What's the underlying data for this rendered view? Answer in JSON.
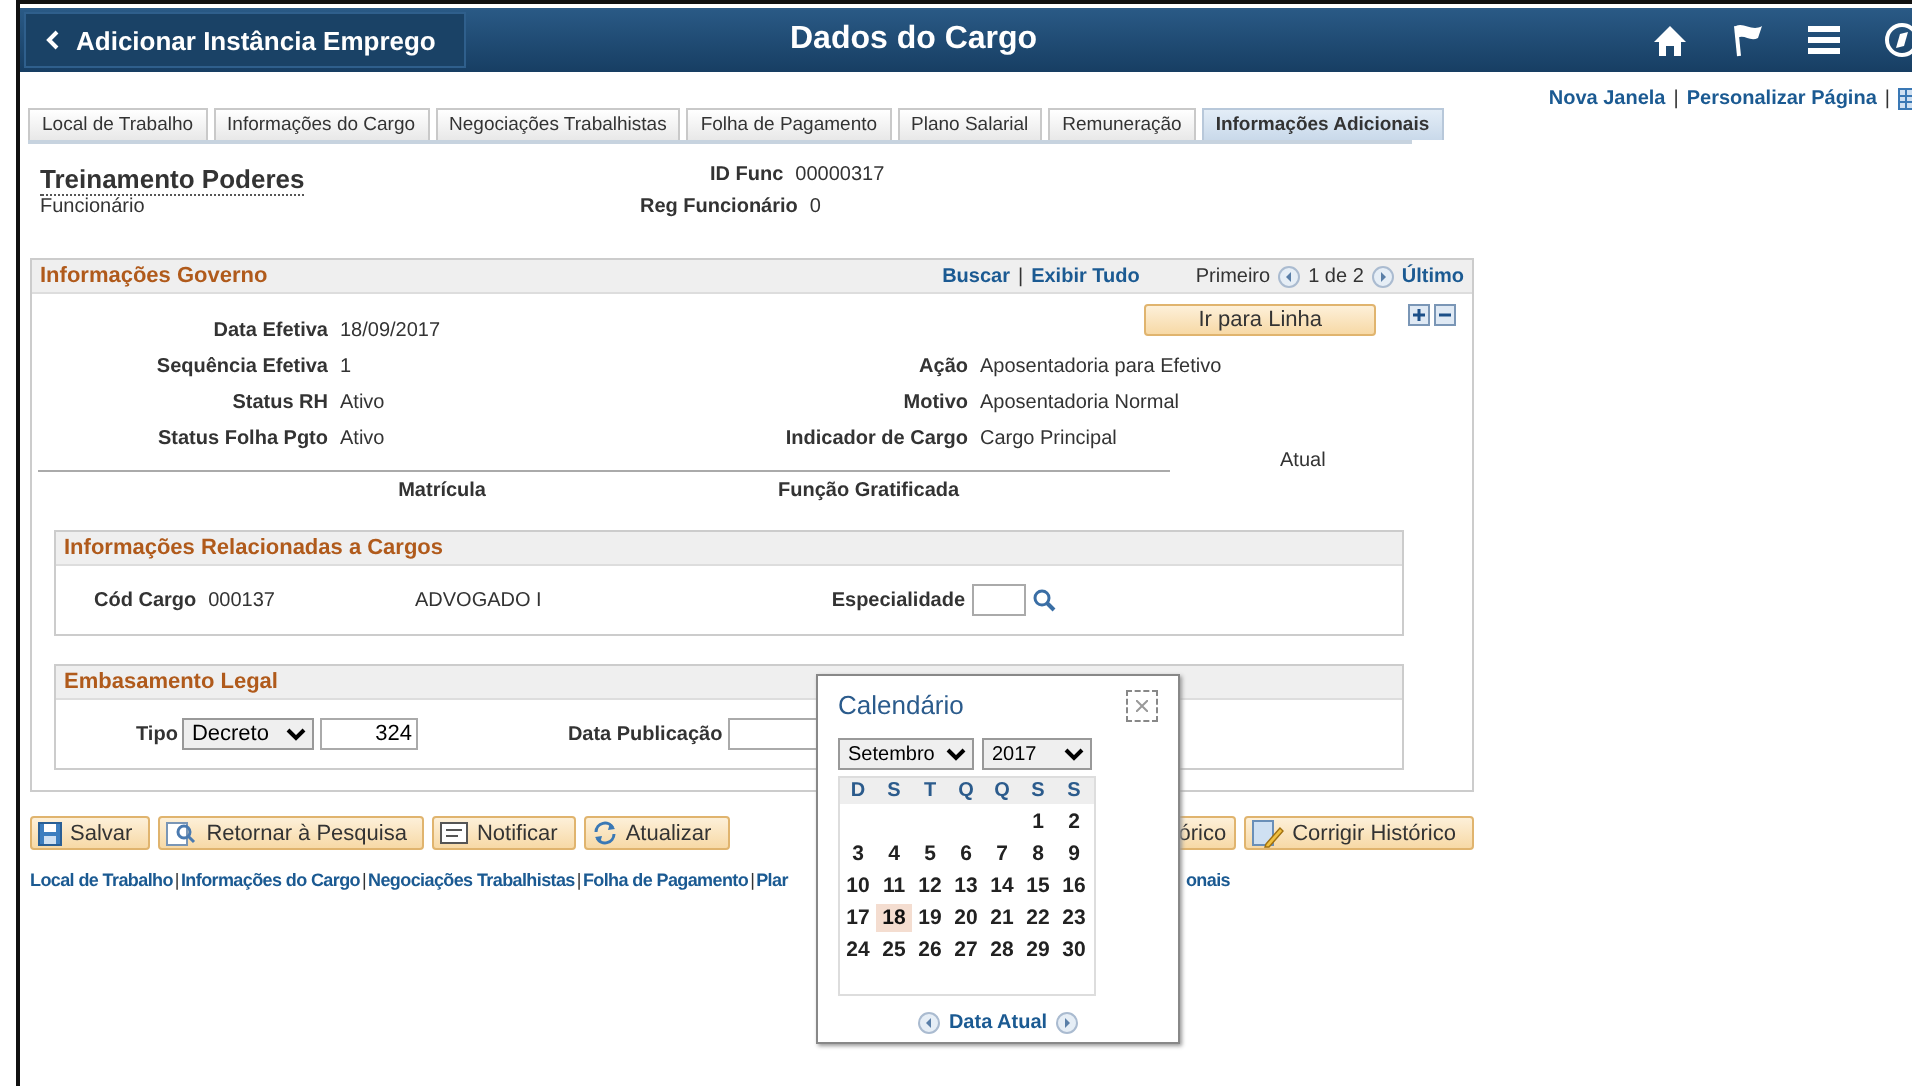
{
  "header": {
    "back_label": "Adicionar Instância Emprego",
    "title": "Dados do Cargo"
  },
  "top_links": [
    {
      "kind": "link",
      "text": "Nova Janela"
    },
    {
      "kind": "separator",
      "text": "|"
    },
    {
      "kind": "link",
      "text": "Personalizar Página"
    },
    {
      "kind": "separator",
      "text": "|"
    }
  ],
  "tabs": [
    {
      "label": "Local de Trabalho",
      "selected": false
    },
    {
      "label": "Informações do Cargo",
      "selected": false
    },
    {
      "label": "Negociações Trabalhistas",
      "selected": false
    },
    {
      "label": "Folha de Pagamento",
      "selected": false
    },
    {
      "label": "Plano Salarial",
      "selected": false
    },
    {
      "label": "Remuneração",
      "selected": false
    },
    {
      "label": "Informações Adicionais",
      "selected": true
    }
  ],
  "employee": {
    "name": "Treinamento Poderes",
    "type": "Funcionário",
    "fields": [
      {
        "label": "ID Func",
        "value": "00000317"
      },
      {
        "label": "Reg Funcionário",
        "value": "0"
      }
    ]
  },
  "governo": {
    "title": "Informações Governo",
    "links": [
      {
        "kind": "link",
        "text": "Buscar"
      },
      {
        "kind": "separator",
        "text": "|"
      },
      {
        "kind": "link",
        "text": "Exibir Tudo"
      }
    ],
    "nav": {
      "first": "Primeiro",
      "count": "1 de 2",
      "last": "Último"
    },
    "go_button": "Ir para Linha",
    "left_fields": [
      {
        "label": "Data Efetiva",
        "value": "18/09/2017"
      },
      {
        "label": "Sequência Efetiva",
        "value": "1"
      },
      {
        "label": "Status RH",
        "value": "Ativo"
      },
      {
        "label": "Status Folha Pgto",
        "value": "Ativo"
      }
    ],
    "right_fields": [
      {
        "label": "Ação",
        "value": "Aposentadoria para Efetivo"
      },
      {
        "label": "Motivo",
        "value": "Aposentadoria Normal"
      },
      {
        "label": "Indicador de Cargo",
        "value": "Cargo Principal"
      }
    ],
    "status": "Atual",
    "matricula": "Matrícula",
    "funcao": "Função Gratificada"
  },
  "cargos": {
    "title": "Informações Relacionadas a Cargos",
    "cod_label": "Cód Cargo",
    "cod_value": "000137",
    "cod_desc": "ADVOGADO I",
    "esp_label": "Especialidade"
  },
  "legal": {
    "title": "Embasamento Legal",
    "tipo_label": "Tipo",
    "tipo_value": "Decreto",
    "numero": "324",
    "data_label": "Data Publicação"
  },
  "buttons": [
    {
      "label": "Salvar",
      "kind": "save"
    },
    {
      "label": "Retornar à Pesquisa",
      "kind": "search"
    },
    {
      "label": "Notificar",
      "kind": "notify"
    },
    {
      "label": "Atualizar",
      "kind": "refresh"
    }
  ],
  "right_buttons": [
    {
      "label": "órico",
      "kind": "partial"
    },
    {
      "label": "Corrigir Histórico",
      "kind": "edit"
    }
  ],
  "bottom_links": [
    {
      "kind": "link",
      "text": "Local de Trabalho"
    },
    {
      "kind": "separator",
      "text": "|"
    },
    {
      "kind": "link",
      "text": "Informações do Cargo"
    },
    {
      "kind": "separator",
      "text": "|"
    },
    {
      "kind": "link",
      "text": "Negociações Trabalhistas"
    },
    {
      "kind": "separator",
      "text": "|"
    },
    {
      "kind": "link",
      "text": "Folha de Pagamento"
    },
    {
      "kind": "separator",
      "text": "|"
    },
    {
      "kind": "link",
      "text": "Plar"
    }
  ],
  "bottom_links_tail": "onais",
  "calendar": {
    "title": "Calendário",
    "month": "Setembro",
    "year": "2017",
    "weekdays": [
      "D",
      "S",
      "T",
      "Q",
      "Q",
      "S",
      "S"
    ],
    "today_link": "Data Atual",
    "weeks": [
      [
        {
          "day": "1",
          "selected": false
        },
        {
          "day": "2",
          "selected": false
        }
      ],
      [
        {
          "day": "3",
          "selected": false
        },
        {
          "day": "4",
          "selected": false
        },
        {
          "day": "5",
          "selected": false
        },
        {
          "day": "6",
          "selected": false
        },
        {
          "day": "7",
          "selected": false
        },
        {
          "day": "8",
          "selected": false
        },
        {
          "day": "9",
          "selected": false
        }
      ],
      [
        {
          "day": "10",
          "selected": false
        },
        {
          "day": "11",
          "selected": false
        },
        {
          "day": "12",
          "selected": false
        },
        {
          "day": "13",
          "selected": false
        },
        {
          "day": "14",
          "selected": false
        },
        {
          "day": "15",
          "selected": false
        },
        {
          "day": "16",
          "selected": false
        }
      ],
      [
        {
          "day": "17",
          "selected": false
        },
        {
          "day": "18",
          "selected": true
        },
        {
          "day": "19",
          "selected": false
        },
        {
          "day": "20",
          "selected": false
        },
        {
          "day": "21",
          "selected": false
        },
        {
          "day": "22",
          "selected": false
        },
        {
          "day": "23",
          "selected": false
        }
      ],
      [
        {
          "day": "24",
          "selected": false
        },
        {
          "day": "25",
          "selected": false
        },
        {
          "day": "26",
          "selected": false
        },
        {
          "day": "27",
          "selected": false
        },
        {
          "day": "28",
          "selected": false
        },
        {
          "day": "29",
          "selected": false
        },
        {
          "day": "30",
          "selected": false
        }
      ]
    ]
  }
}
